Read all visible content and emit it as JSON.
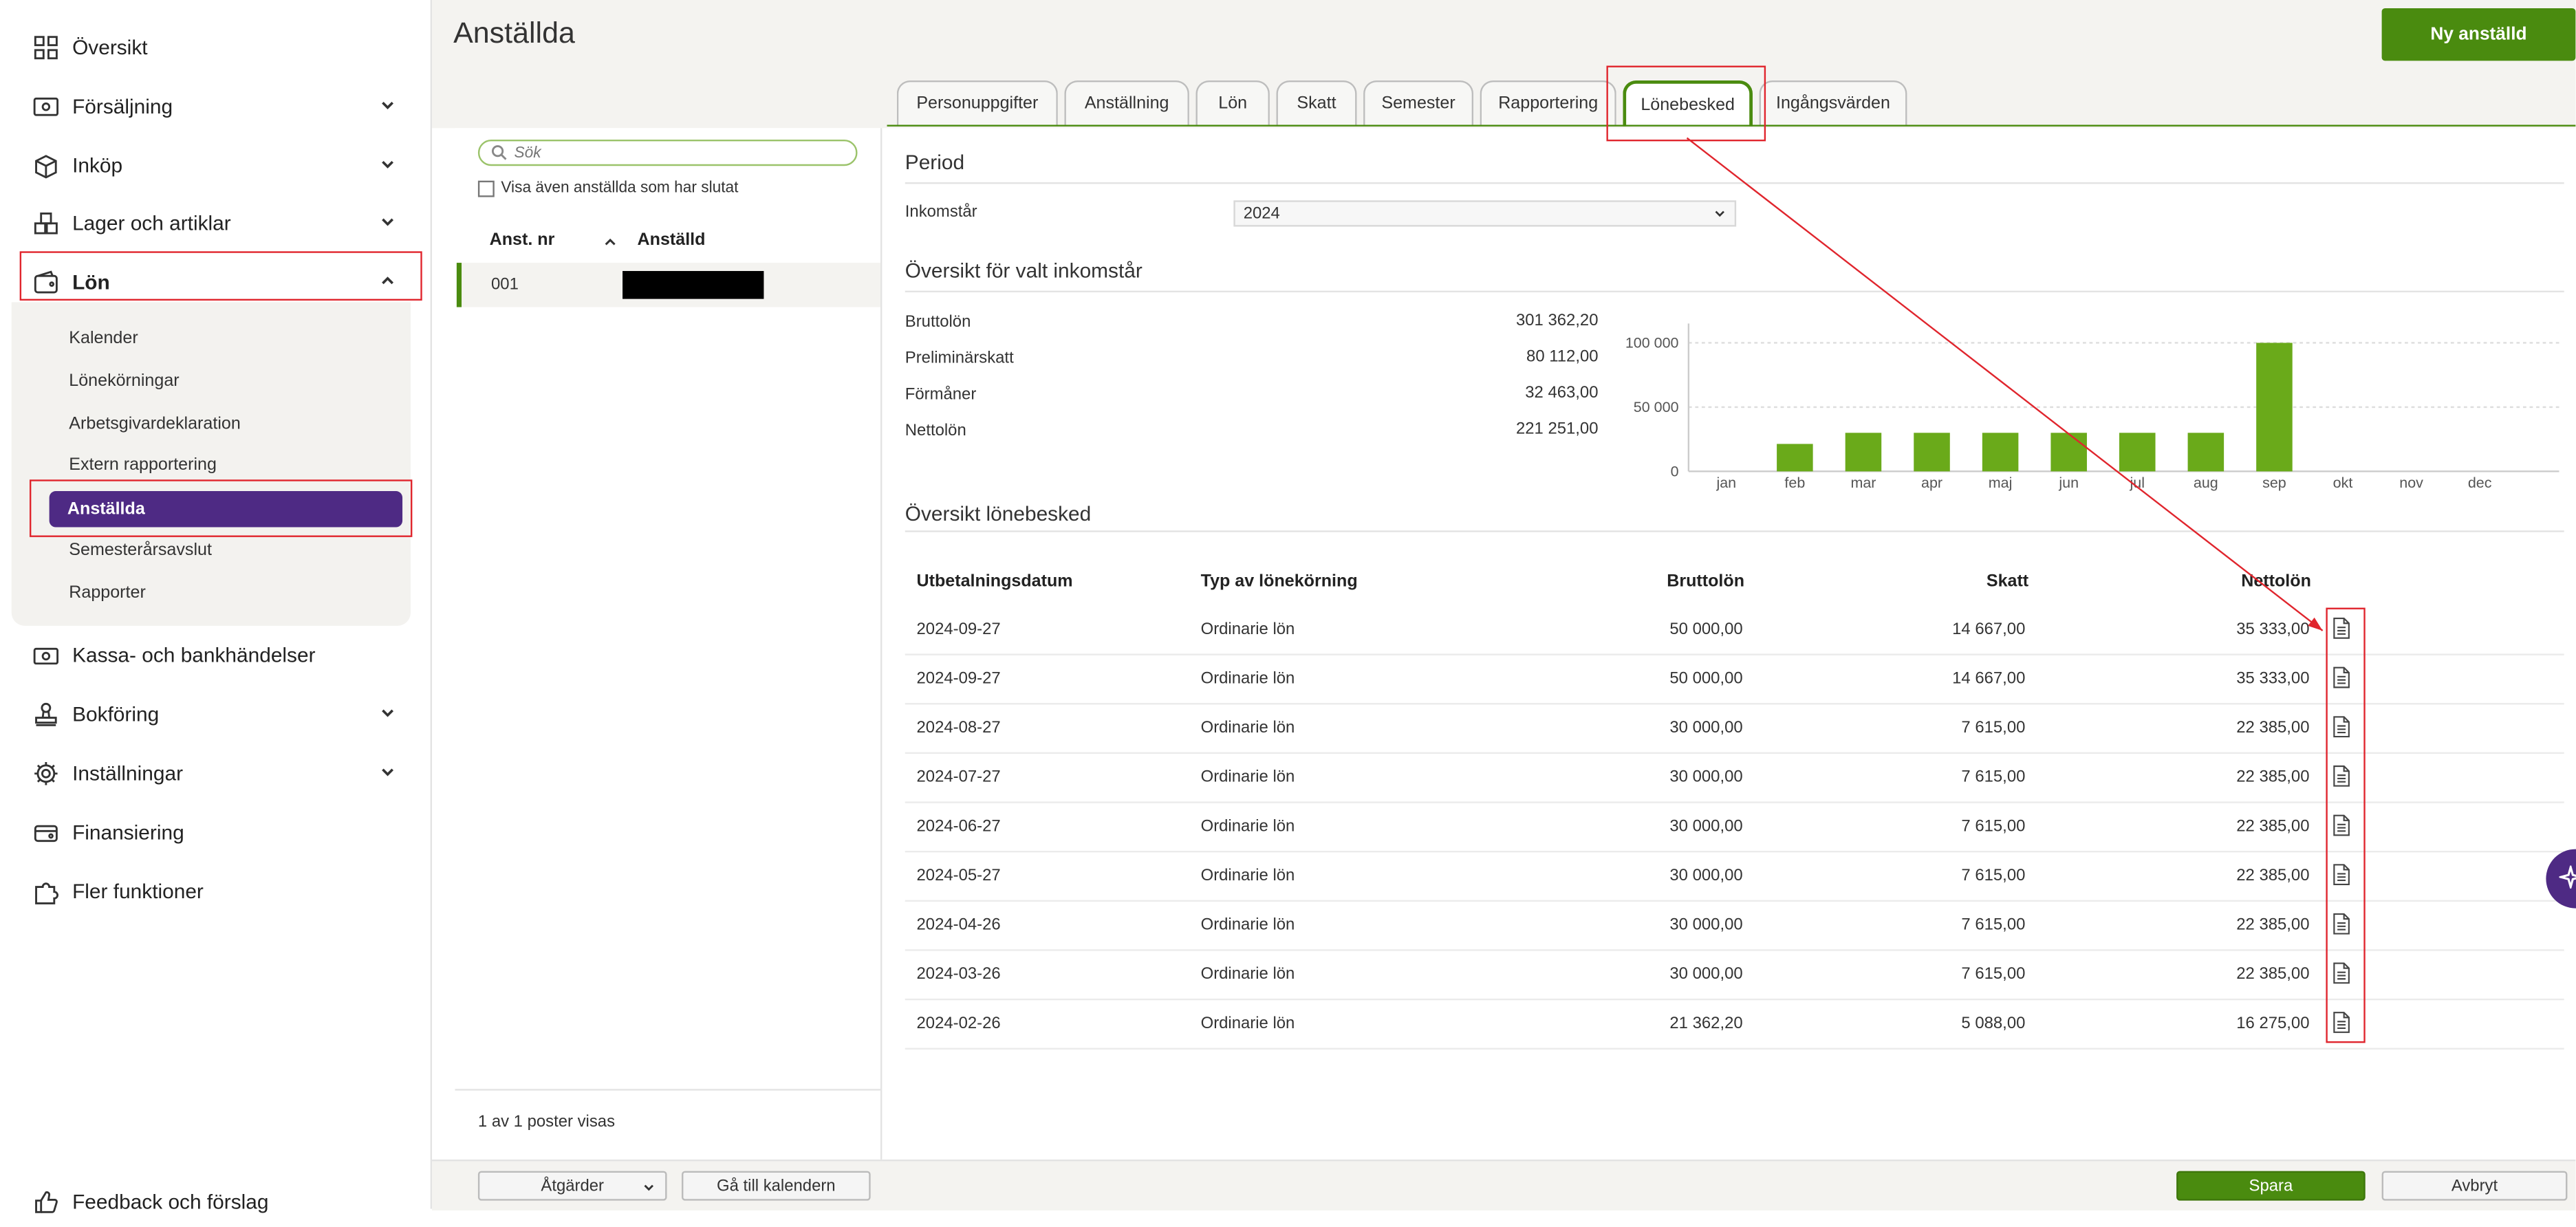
{
  "sidebar": {
    "items": [
      {
        "label": "Översikt",
        "icon": "grid-icon"
      },
      {
        "label": "Försäljning",
        "icon": "cash-register-icon"
      },
      {
        "label": "Inköp",
        "icon": "box-icon"
      },
      {
        "label": "Lager och artiklar",
        "icon": "boxes-icon"
      },
      {
        "label": "Lön",
        "icon": "wallet-icon"
      },
      {
        "label": "Kassa- och bankhändelser",
        "icon": "money-icon"
      },
      {
        "label": "Bokföring",
        "icon": "stamp-icon"
      },
      {
        "label": "Inställningar",
        "icon": "gear-icon"
      },
      {
        "label": "Finansiering",
        "icon": "finance-icon"
      },
      {
        "label": "Fler funktioner",
        "icon": "puzzle-icon"
      },
      {
        "label": "Feedback och förslag",
        "icon": "thumbs-up-icon"
      }
    ],
    "submenu": [
      "Kalender",
      "Lönekörningar",
      "Arbetsgivardeklaration",
      "Extern rapportering",
      "Anställda",
      "Semesterårsavslut",
      "Rapporter"
    ]
  },
  "header": {
    "title": "Anställda",
    "new_button": "Ny anställd"
  },
  "tabs": [
    "Personuppgifter",
    "Anställning",
    "Lön",
    "Skatt",
    "Semester",
    "Rapportering",
    "Lönebesked",
    "Ingångsvärden"
  ],
  "list": {
    "search_placeholder": "Sök",
    "checkbox_label": "Visa även anställda som har slutat",
    "col_nr": "Anst. nr",
    "col_name": "Anställd",
    "rows": [
      {
        "nr": "001"
      }
    ],
    "count_text": "1 av 1 poster visas"
  },
  "period": {
    "title": "Period",
    "income_year_label": "Inkomstår",
    "income_year": "2024"
  },
  "overview": {
    "title": "Översikt för valt inkomstår",
    "rows": [
      {
        "label": "Bruttolön",
        "value": "301 362,20"
      },
      {
        "label": "Preliminärskatt",
        "value": "80 112,00"
      },
      {
        "label": "Förmåner",
        "value": "32 463,00"
      },
      {
        "label": "Nettolön",
        "value": "221 251,00"
      }
    ]
  },
  "chart_data": {
    "type": "bar",
    "categories": [
      "jan",
      "feb",
      "mar",
      "apr",
      "maj",
      "jun",
      "jul",
      "aug",
      "sep",
      "okt",
      "nov",
      "dec"
    ],
    "values": [
      0,
      21362,
      30000,
      30000,
      30000,
      30000,
      30000,
      30000,
      100000,
      0,
      0,
      0
    ],
    "yticks": [
      "0",
      "50 000",
      "100 000"
    ],
    "ylim": [
      0,
      115000
    ],
    "color": "#6aaa1a"
  },
  "payslips": {
    "title": "Översikt lönebesked",
    "headers": [
      "Utbetalningsdatum",
      "Typ av lönekörning",
      "Bruttolön",
      "Skatt",
      "Nettolön"
    ],
    "rows": [
      {
        "date": "2024-09-27",
        "type": "Ordinarie lön",
        "gross": "50 000,00",
        "tax": "14 667,00",
        "net": "35 333,00"
      },
      {
        "date": "2024-09-27",
        "type": "Ordinarie lön",
        "gross": "50 000,00",
        "tax": "14 667,00",
        "net": "35 333,00"
      },
      {
        "date": "2024-08-27",
        "type": "Ordinarie lön",
        "gross": "30 000,00",
        "tax": "7 615,00",
        "net": "22 385,00"
      },
      {
        "date": "2024-07-27",
        "type": "Ordinarie lön",
        "gross": "30 000,00",
        "tax": "7 615,00",
        "net": "22 385,00"
      },
      {
        "date": "2024-06-27",
        "type": "Ordinarie lön",
        "gross": "30 000,00",
        "tax": "7 615,00",
        "net": "22 385,00"
      },
      {
        "date": "2024-05-27",
        "type": "Ordinarie lön",
        "gross": "30 000,00",
        "tax": "7 615,00",
        "net": "22 385,00"
      },
      {
        "date": "2024-04-26",
        "type": "Ordinarie lön",
        "gross": "30 000,00",
        "tax": "7 615,00",
        "net": "22 385,00"
      },
      {
        "date": "2024-03-26",
        "type": "Ordinarie lön",
        "gross": "30 000,00",
        "tax": "7 615,00",
        "net": "22 385,00"
      },
      {
        "date": "2024-02-26",
        "type": "Ordinarie lön",
        "gross": "21 362,20",
        "tax": "5 088,00",
        "net": "16 275,00"
      }
    ]
  },
  "footer": {
    "actions": "Åtgärder",
    "calendar": "Gå till kalendern",
    "save": "Spara",
    "cancel": "Avbryt"
  },
  "colors": {
    "accent": "#4a8b0f",
    "purple": "#4e2a84",
    "annotation": "#e0252d"
  }
}
